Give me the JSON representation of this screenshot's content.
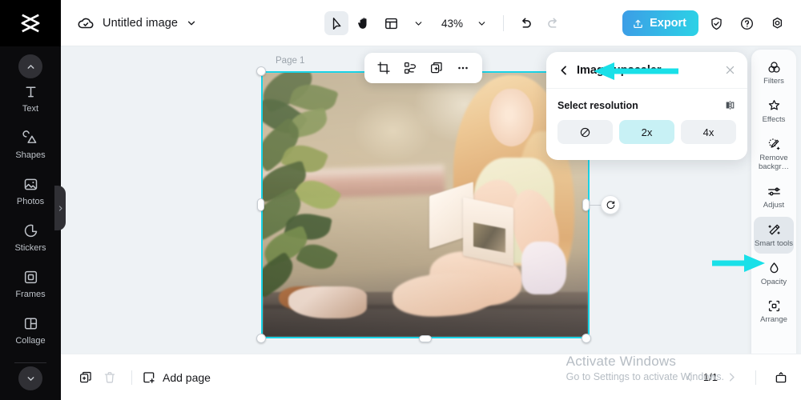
{
  "app": {
    "logo": "capcut-logo",
    "document_title": "Untitled image",
    "zoom_level": "43%"
  },
  "topbar": {
    "cloud_icon": "cloud-saved-icon",
    "title_dropdown_icon": "chevron-down-icon",
    "tools": [
      {
        "name": "select-tool",
        "icon": "cursor-arrow-icon",
        "active": true
      },
      {
        "name": "hand-tool",
        "icon": "hand-icon",
        "active": false
      },
      {
        "name": "layout-tool",
        "icon": "layout-grid-icon",
        "active": false
      }
    ],
    "layout_dropdown_icon": "chevron-down-icon",
    "zoom_dropdown_icon": "chevron-down-icon",
    "undo_label": "undo-icon",
    "redo_label": "redo-icon",
    "redo_disabled": true,
    "export_label": "Export",
    "export_icon": "upload-icon",
    "shield_icon": "shield-check-icon",
    "help_icon": "question-circle-icon",
    "settings_icon": "settings-gear-icon"
  },
  "left_sidebar": {
    "scroll_up_icon": "chevron-up-icon",
    "scroll_down_icon": "chevron-down-icon",
    "collapse_handle_icon": "chevron-right-icon",
    "items": [
      {
        "label": "Text",
        "icon": "text-icon"
      },
      {
        "label": "Shapes",
        "icon": "shapes-icon"
      },
      {
        "label": "Photos",
        "icon": "photo-icon"
      },
      {
        "label": "Stickers",
        "icon": "sticker-icon"
      },
      {
        "label": "Frames",
        "icon": "frame-icon"
      },
      {
        "label": "Collage",
        "icon": "collage-icon"
      }
    ]
  },
  "canvas": {
    "page_label": "Page 1",
    "selection_color": "#19d3e6",
    "rotate_handle_icon": "rotate-icon",
    "object_toolbar": [
      {
        "name": "crop-button",
        "icon": "crop-icon"
      },
      {
        "name": "transform-button",
        "icon": "transform-nodes-icon"
      },
      {
        "name": "duplicate-button",
        "icon": "duplicate-plus-icon"
      },
      {
        "name": "more-options-button",
        "icon": "ellipsis-icon"
      }
    ],
    "image_description": "Blonde young woman sitting on a wooden deck outdoors reading an open book, green leafy foliage on the left, sunlit bokeh background"
  },
  "upscaler_panel": {
    "back_icon": "chevron-left-icon",
    "title": "Image upscaler",
    "close_icon": "close-x-icon",
    "section_label": "Select resolution",
    "compare_icon": "compare-split-icon",
    "options": [
      {
        "label": "",
        "icon": "no-upscale-icon",
        "selected": false
      },
      {
        "label": "2x",
        "icon": "",
        "selected": true
      },
      {
        "label": "4x",
        "icon": "",
        "selected": false
      }
    ],
    "selected_option": "2x",
    "selected_color": "#c8f1f5"
  },
  "right_panel": {
    "items": [
      {
        "label": "Filters",
        "icon": "filters-circles-icon",
        "active": false
      },
      {
        "label": "Effects",
        "icon": "effects-star-icon",
        "active": false
      },
      {
        "label": "Remove backgr…",
        "icon": "remove-background-icon",
        "active": false
      },
      {
        "label": "Adjust",
        "icon": "adjust-sliders-icon",
        "active": false
      },
      {
        "label": "Smart tools",
        "icon": "smart-tools-wand-icon",
        "active": true
      },
      {
        "label": "Opacity",
        "icon": "opacity-drop-icon",
        "active": false
      },
      {
        "label": "Arrange",
        "icon": "arrange-icon",
        "active": false
      }
    ]
  },
  "annotations": {
    "arrow_color": "#19e0e8",
    "arrow_to_title": "arrow-pointing-left-to-image-upscaler",
    "arrow_to_smart_tools": "arrow-pointing-right-to-smart-tools"
  },
  "bottombar": {
    "duplicate_page_icon": "duplicate-page-icon",
    "delete_page_icon": "trash-icon",
    "delete_disabled": true,
    "add_page_label": "Add page",
    "add_page_icon": "add-square-icon",
    "prev_page_icon": "chevron-left-icon",
    "page_indicator": "1/1",
    "next_page_icon": "chevron-right-icon",
    "present_icon": "present-screen-icon"
  },
  "watermark": {
    "line1": "Activate Windows",
    "line2": "Go to Settings to activate Windows."
  }
}
